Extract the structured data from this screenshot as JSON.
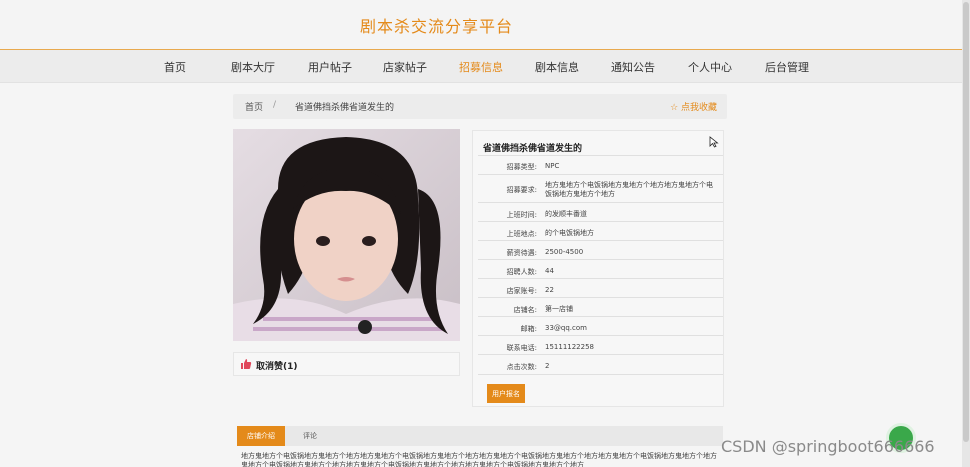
{
  "header": {
    "title": "剧本杀交流分享平台"
  },
  "nav": {
    "items": [
      {
        "label": "首页"
      },
      {
        "label": "剧本大厅"
      },
      {
        "label": "用户帖子"
      },
      {
        "label": "店家帖子"
      },
      {
        "label": "招募信息",
        "active": true
      },
      {
        "label": "剧本信息"
      },
      {
        "label": "通知公告"
      },
      {
        "label": "个人中心"
      },
      {
        "label": "后台管理"
      }
    ]
  },
  "breadcrumb": {
    "home": "首页",
    "separator": "/",
    "current": "省道佛挡杀佛省道发生的"
  },
  "collect": {
    "label": "☆ 点我收藏"
  },
  "like": {
    "label": "取消赞(1)"
  },
  "details": {
    "title": "省道佛挡杀佛省道发生的",
    "rows": [
      {
        "label": "招募类型:",
        "value": "NPC"
      },
      {
        "label": "招募要求:",
        "value": "地方鬼地方个电饭锅地方鬼地方个地方地方鬼地方个电饭锅地方鬼地方个地方"
      },
      {
        "label": "上班时间:",
        "value": "的发顺丰番道"
      },
      {
        "label": "上班地点:",
        "value": "的个电饭锅地方"
      },
      {
        "label": "薪资待遇:",
        "value": "2500-4500"
      },
      {
        "label": "招聘人数:",
        "value": "44"
      },
      {
        "label": "店家账号:",
        "value": "22"
      },
      {
        "label": "店铺名:",
        "value": "第一店铺"
      },
      {
        "label": "邮箱:",
        "value": "33@qq.com"
      },
      {
        "label": "联系电话:",
        "value": "15111122258"
      },
      {
        "label": "点击次数:",
        "value": "2"
      }
    ],
    "apply_button": "用户报名"
  },
  "tabs": [
    {
      "label": "店铺介绍",
      "active": true
    },
    {
      "label": "评论"
    }
  ],
  "description": "地方鬼地方个电饭锅地方鬼地方个地方地方鬼地方个电饭锅地方鬼地方个地方地方鬼地方个电饭锅地方鬼地方个地方地方鬼地方个电饭锅地方鬼地方个地方鬼地方个电饭锅地方鬼地方个地方地方鬼地方个电饭锅地方鬼地方个地方地方鬼地方个电饭锅地方鬼地方个地方",
  "watermark": "CSDN @springboot666666",
  "colors": {
    "accent": "#e48a1a",
    "float_button": "#3aa84a"
  }
}
